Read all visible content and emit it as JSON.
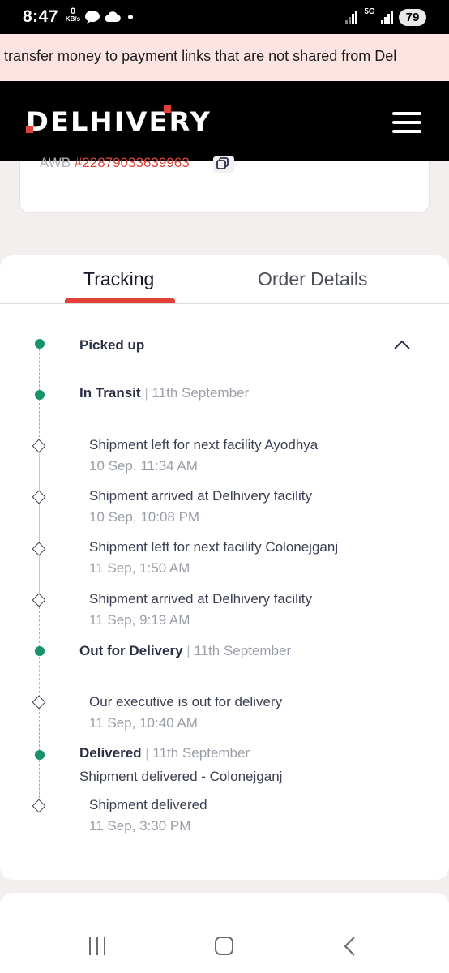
{
  "status_bar": {
    "time": "8:47",
    "data_rate_value": "0",
    "data_rate_unit": "KB/s",
    "network": "5G",
    "battery": "79"
  },
  "notice": {
    "text": "transfer money to payment links that are not shared from Del"
  },
  "header": {
    "logo_text": "DELHIVERY",
    "menu_icon": "hamburger-menu-icon"
  },
  "shipment": {
    "awb_label": "AWB",
    "awb_number": "#22879033639963"
  },
  "tabs": [
    {
      "label": "Tracking",
      "active": true
    },
    {
      "label": "Order Details",
      "active": false
    }
  ],
  "timeline": {
    "picked_up": {
      "title": "Picked up"
    },
    "in_transit": {
      "title": "In Transit",
      "date": "11th September"
    },
    "transit_events": [
      {
        "text": "Shipment left for next facility Ayodhya",
        "time": "10 Sep, 11:34 AM"
      },
      {
        "text": "Shipment arrived at Delhivery facility",
        "time": "10 Sep, 10:08 PM"
      },
      {
        "text": "Shipment left for next facility Colonejganj",
        "time": "11 Sep, 1:50 AM"
      },
      {
        "text": "Shipment arrived at Delhivery facility",
        "time": "11 Sep, 9:19 AM"
      }
    ],
    "out_for_delivery": {
      "title": "Out for Delivery",
      "date": "11th September"
    },
    "ofd_events": [
      {
        "text": "Our executive is out for delivery",
        "time": "11 Sep, 10:40 AM"
      }
    ],
    "delivered": {
      "title": "Delivered",
      "date": "11th September",
      "description": "Shipment delivered - Colonejganj"
    },
    "delivered_events": [
      {
        "text": "Shipment delivered",
        "time": "11 Sep, 3:30 PM"
      }
    ]
  },
  "colors": {
    "accent": "#e14136",
    "status_green": "#17936a",
    "awb_red": "#d9443a"
  }
}
